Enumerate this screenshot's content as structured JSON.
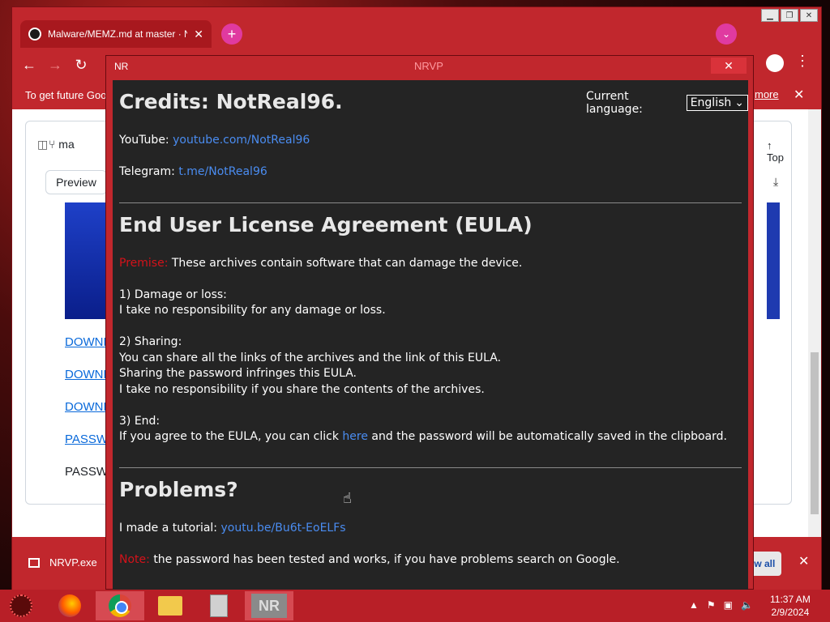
{
  "browser": {
    "tab_title": "Malware/MEMZ.md at master · N",
    "new_tab_label": "+",
    "infobar_text": "To get future Goo",
    "infobar_more": "more",
    "gh": {
      "branch": "ma",
      "top_label": "Top",
      "preview_label": "Preview",
      "links": [
        "DOWNLO",
        "DOWNLO",
        "DOWNLO",
        "PASSWOR"
      ],
      "text_item": "PASSWOR"
    },
    "download": {
      "file_name": "NRVP.exe",
      "show_all": "ow all"
    }
  },
  "dialog": {
    "title": "NR",
    "caption": "NRVP",
    "close_label": "✕",
    "language_label": "Current language:",
    "language_value": "English",
    "credits_heading": "Credits: NotReal96.",
    "youtube_label": "YouTube:",
    "youtube_link": "youtube.com/NotReal96",
    "telegram_label": "Telegram:",
    "telegram_link": "t.me/NotReal96",
    "eula_heading": "End User License Agreement (EULA)",
    "premise_label": "Premise:",
    "premise_text": "These archives contain software that can damage the device.",
    "s1_title": "1) Damage or loss:",
    "s1_text": "I take no responsibility for any damage or loss.",
    "s2_title": "2) Sharing:",
    "s2_line1": "You can share all the links of the archives and the link of this EULA.",
    "s2_line2": "Sharing the password infringes this EULA.",
    "s2_line3": "I take no responsibility if you share the contents of the archives.",
    "s3_title": "3) End:",
    "s3_before": "If you agree to the EULA, you can click",
    "s3_link": "here",
    "s3_after": "and the password will be automatically saved in the clipboard.",
    "problems_heading": "Problems?",
    "tutorial_label": "I made a tutorial:",
    "tutorial_link": "youtu.be/Bu6t-EoELFs",
    "note_label": "Note:",
    "note_text": "the password has been tested and works, if you have problems search on Google."
  },
  "taskbar": {
    "nr_label": "NR",
    "time": "11:37 AM",
    "date": "2/9/2024"
  },
  "colors": {
    "accent_red": "#c1272d",
    "link_blue": "#4a8cf0",
    "warning_red": "#d4121a",
    "dialog_bg": "#242424"
  }
}
